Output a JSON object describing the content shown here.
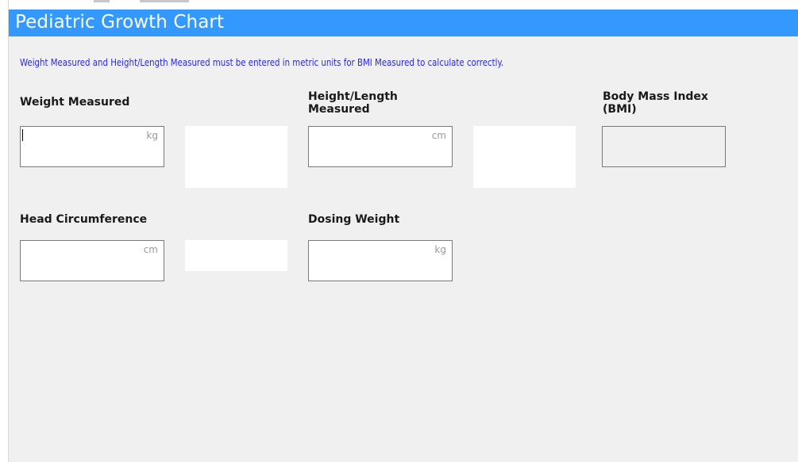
{
  "title": "Pediatric Growth Chart",
  "notice": "Weight Measured and Height/Length Measured must be entered in metric units for BMI Measured to calculate correctly.",
  "fields": {
    "weight_measured": {
      "label": "Weight Measured",
      "value": "",
      "unit": "kg"
    },
    "height_length_measured": {
      "label": "Height/Length\nMeasured",
      "value": "",
      "unit": "cm"
    },
    "bmi": {
      "label": "Body Mass Index\n(BMI)",
      "value": ""
    },
    "head_circumference": {
      "label": "Head Circumference",
      "value": "",
      "unit": "cm"
    },
    "dosing_weight": {
      "label": "Dosing Weight",
      "value": "",
      "unit": "kg"
    }
  },
  "colors": {
    "title_bar": "#3399ff",
    "notice_text": "#2b2bd6",
    "panel_background": "#f0f0f0"
  }
}
